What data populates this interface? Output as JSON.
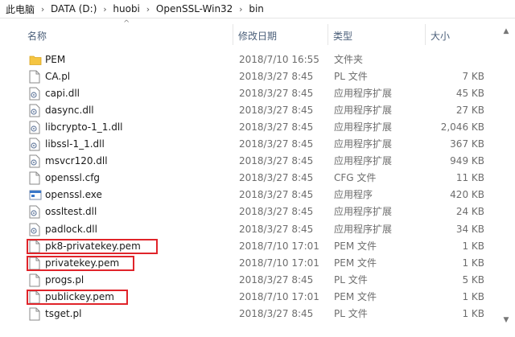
{
  "breadcrumb": [
    "此电脑",
    "DATA (D:)",
    "huobi",
    "OpenSSL-Win32",
    "bin"
  ],
  "header": {
    "name": "名称",
    "date": "修改日期",
    "type": "类型",
    "size": "大小"
  },
  "files": [
    {
      "name": "PEM",
      "date": "2018/7/10 16:55",
      "type": "文件夹",
      "size": "",
      "icon": "folder-icon"
    },
    {
      "name": "CA.pl",
      "date": "2018/3/27 8:45",
      "type": "PL 文件",
      "size": "7 KB",
      "icon": "file-icon"
    },
    {
      "name": "capi.dll",
      "date": "2018/3/27 8:45",
      "type": "应用程序扩展",
      "size": "45 KB",
      "icon": "dll-icon"
    },
    {
      "name": "dasync.dll",
      "date": "2018/3/27 8:45",
      "type": "应用程序扩展",
      "size": "27 KB",
      "icon": "dll-icon"
    },
    {
      "name": "libcrypto-1_1.dll",
      "date": "2018/3/27 8:45",
      "type": "应用程序扩展",
      "size": "2,046 KB",
      "icon": "dll-icon"
    },
    {
      "name": "libssl-1_1.dll",
      "date": "2018/3/27 8:45",
      "type": "应用程序扩展",
      "size": "367 KB",
      "icon": "dll-icon"
    },
    {
      "name": "msvcr120.dll",
      "date": "2018/3/27 8:45",
      "type": "应用程序扩展",
      "size": "949 KB",
      "icon": "dll-icon"
    },
    {
      "name": "openssl.cfg",
      "date": "2018/3/27 8:45",
      "type": "CFG 文件",
      "size": "11 KB",
      "icon": "file-icon"
    },
    {
      "name": "openssl.exe",
      "date": "2018/3/27 8:45",
      "type": "应用程序",
      "size": "420 KB",
      "icon": "exe-icon"
    },
    {
      "name": "ossltest.dll",
      "date": "2018/3/27 8:45",
      "type": "应用程序扩展",
      "size": "24 KB",
      "icon": "dll-icon"
    },
    {
      "name": "padlock.dll",
      "date": "2018/3/27 8:45",
      "type": "应用程序扩展",
      "size": "34 KB",
      "icon": "dll-icon"
    },
    {
      "name": "pk8-privatekey.pem",
      "date": "2018/7/10 17:01",
      "type": "PEM 文件",
      "size": "1 KB",
      "icon": "file-icon",
      "highlighted": true
    },
    {
      "name": "privatekey.pem",
      "date": "2018/7/10 17:01",
      "type": "PEM 文件",
      "size": "1 KB",
      "icon": "file-icon",
      "highlighted": true
    },
    {
      "name": "progs.pl",
      "date": "2018/3/27 8:45",
      "type": "PL 文件",
      "size": "5 KB",
      "icon": "file-icon"
    },
    {
      "name": "publickey.pem",
      "date": "2018/7/10 17:01",
      "type": "PEM 文件",
      "size": "1 KB",
      "icon": "file-icon",
      "highlighted": true
    },
    {
      "name": "tsget.pl",
      "date": "2018/3/27 8:45",
      "type": "PL 文件",
      "size": "1 KB",
      "icon": "file-icon"
    }
  ],
  "colors": {
    "highlight": "#e0242a",
    "header_text": "#4c607a",
    "folder": "#f5c542"
  }
}
